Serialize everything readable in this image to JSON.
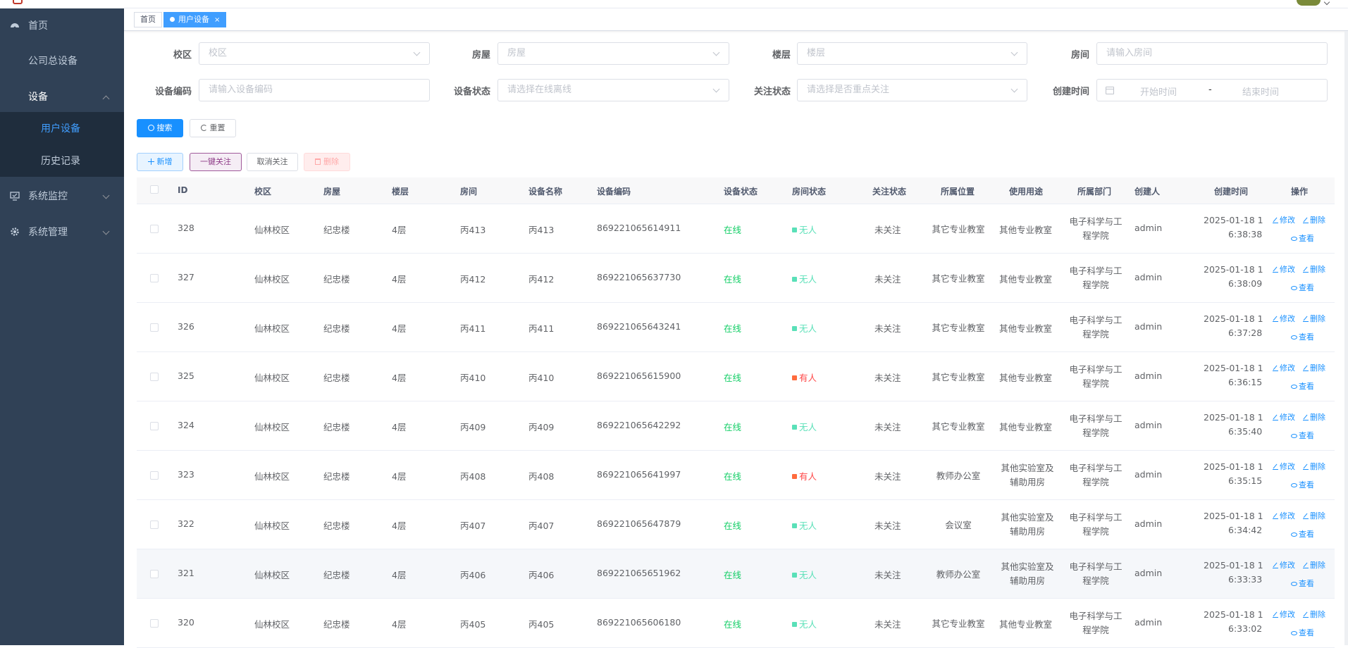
{
  "sidebar": {
    "items": [
      {
        "label": "首页",
        "icon": "dashboard-icon"
      },
      {
        "label": "公司总设备"
      },
      {
        "label": "设备",
        "expanded": true
      },
      {
        "label": "用户设备",
        "active": true
      },
      {
        "label": "历史记录"
      },
      {
        "label": "系统监控",
        "icon": "monitor-icon"
      },
      {
        "label": "系统管理",
        "icon": "gear-icon"
      }
    ]
  },
  "tags": {
    "home": "首页",
    "current": "用户设备",
    "close": "×"
  },
  "filters": {
    "campus": {
      "label": "校区",
      "placeholder": "校区"
    },
    "building": {
      "label": "房屋",
      "placeholder": "房屋"
    },
    "floor": {
      "label": "楼层",
      "placeholder": "楼层"
    },
    "room": {
      "label": "房间",
      "placeholder": "请输入房间"
    },
    "device_code": {
      "label": "设备编码",
      "placeholder": "请输入设备编码"
    },
    "device_status": {
      "label": "设备状态",
      "placeholder": "请选择在线离线"
    },
    "follow_status": {
      "label": "关注状态",
      "placeholder": "请选择是否重点关注"
    },
    "created_time": {
      "label": "创建时间",
      "start": "开始时间",
      "separator": "-",
      "end": "结束时间"
    }
  },
  "buttons": {
    "search": "搜索",
    "reset": "重置",
    "add": "新增",
    "follow_all": "一键关注",
    "unfollow": "取消关注",
    "delete": "删除"
  },
  "table": {
    "headers": [
      "ID",
      "校区",
      "房屋",
      "楼层",
      "房间",
      "设备名称",
      "设备编码",
      "设备状态",
      "房间状态",
      "关注状态",
      "所属位置",
      "使用用途",
      "所属部门",
      "创建人",
      "创建时间",
      "操作"
    ],
    "op_edit": "修改",
    "op_delete": "删除",
    "op_view": "查看",
    "rows": [
      {
        "id": "328",
        "campus": "仙林校区",
        "building": "纪忠楼",
        "floor": "4层",
        "room": "丙413",
        "name": "丙413",
        "code": "869221065614911",
        "status": "在线",
        "room_status": "无人",
        "occupied": false,
        "follow": "未关注",
        "location": "其它专业教室",
        "usage": "其他专业教室",
        "dept": "电子科学与工程学院",
        "creator": "admin",
        "time1": "2025-01-18 1",
        "time2": "6:38:38"
      },
      {
        "id": "327",
        "campus": "仙林校区",
        "building": "纪忠楼",
        "floor": "4层",
        "room": "丙412",
        "name": "丙412",
        "code": "869221065637730",
        "status": "在线",
        "room_status": "无人",
        "occupied": false,
        "follow": "未关注",
        "location": "其它专业教室",
        "usage": "其他专业教室",
        "dept": "电子科学与工程学院",
        "creator": "admin",
        "time1": "2025-01-18 1",
        "time2": "6:38:09"
      },
      {
        "id": "326",
        "campus": "仙林校区",
        "building": "纪忠楼",
        "floor": "4层",
        "room": "丙411",
        "name": "丙411",
        "code": "869221065643241",
        "status": "在线",
        "room_status": "无人",
        "occupied": false,
        "follow": "未关注",
        "location": "其它专业教室",
        "usage": "其他专业教室",
        "dept": "电子科学与工程学院",
        "creator": "admin",
        "time1": "2025-01-18 1",
        "time2": "6:37:28"
      },
      {
        "id": "325",
        "campus": "仙林校区",
        "building": "纪忠楼",
        "floor": "4层",
        "room": "丙410",
        "name": "丙410",
        "code": "869221065615900",
        "status": "在线",
        "room_status": "有人",
        "occupied": true,
        "follow": "未关注",
        "location": "其它专业教室",
        "usage": "其他专业教室",
        "dept": "电子科学与工程学院",
        "creator": "admin",
        "time1": "2025-01-18 1",
        "time2": "6:36:15"
      },
      {
        "id": "324",
        "campus": "仙林校区",
        "building": "纪忠楼",
        "floor": "4层",
        "room": "丙409",
        "name": "丙409",
        "code": "869221065642292",
        "status": "在线",
        "room_status": "无人",
        "occupied": false,
        "follow": "未关注",
        "location": "其它专业教室",
        "usage": "其他专业教室",
        "dept": "电子科学与工程学院",
        "creator": "admin",
        "time1": "2025-01-18 1",
        "time2": "6:35:40"
      },
      {
        "id": "323",
        "campus": "仙林校区",
        "building": "纪忠楼",
        "floor": "4层",
        "room": "丙408",
        "name": "丙408",
        "code": "869221065641997",
        "status": "在线",
        "room_status": "有人",
        "occupied": true,
        "follow": "未关注",
        "location": "教师办公室",
        "usage": "其他实验室及辅助用房",
        "dept": "电子科学与工程学院",
        "creator": "admin",
        "time1": "2025-01-18 1",
        "time2": "6:35:15"
      },
      {
        "id": "322",
        "campus": "仙林校区",
        "building": "纪忠楼",
        "floor": "4层",
        "room": "丙407",
        "name": "丙407",
        "code": "869221065647879",
        "status": "在线",
        "room_status": "无人",
        "occupied": false,
        "follow": "未关注",
        "location": "会议室",
        "usage": "其他实验室及辅助用房",
        "dept": "电子科学与工程学院",
        "creator": "admin",
        "time1": "2025-01-18 1",
        "time2": "6:34:42"
      },
      {
        "id": "321",
        "campus": "仙林校区",
        "building": "纪忠楼",
        "floor": "4层",
        "room": "丙406",
        "name": "丙406",
        "code": "869221065651962",
        "status": "在线",
        "room_status": "无人",
        "occupied": false,
        "follow": "未关注",
        "location": "教师办公室",
        "usage": "其他实验室及辅助用房",
        "dept": "电子科学与工程学院",
        "creator": "admin",
        "time1": "2025-01-18 1",
        "time2": "6:33:33"
      },
      {
        "id": "320",
        "campus": "仙林校区",
        "building": "纪忠楼",
        "floor": "4层",
        "room": "丙405",
        "name": "丙405",
        "code": "869221065606180",
        "status": "在线",
        "room_status": "无人",
        "occupied": false,
        "follow": "未关注",
        "location": "其它专业教室",
        "usage": "其他专业教室",
        "dept": "电子科学与工程学院",
        "creator": "admin",
        "time1": "2025-01-18 1",
        "time2": "6:33:02"
      }
    ]
  },
  "colors": {
    "sidebar_bg": "#304156",
    "primary": "#1890ff",
    "online": "#13ce66",
    "room_empty": "#5ae0b8",
    "room_occupied": "#ff4949"
  }
}
